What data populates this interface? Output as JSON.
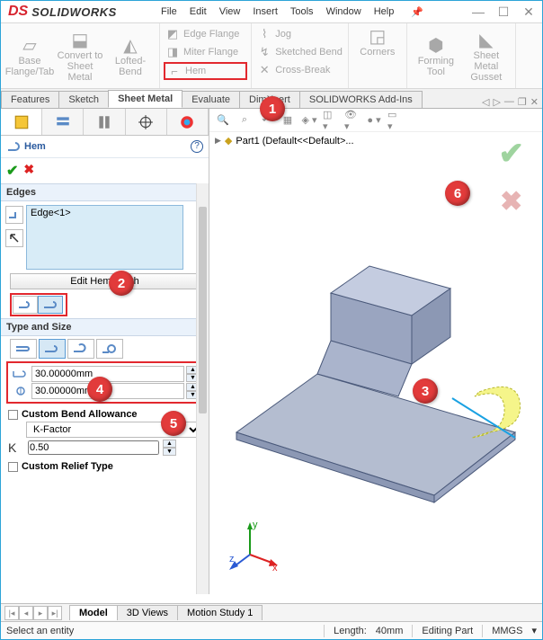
{
  "app": {
    "logo_prefix": "DS",
    "name": "SOLIDWORKS"
  },
  "menu": {
    "file": "File",
    "edit": "Edit",
    "view": "View",
    "insert": "Insert",
    "tools": "Tools",
    "window": "Window",
    "help": "Help"
  },
  "ribbon": {
    "base": "Base Flange/Tab",
    "convert": "Convert to Sheet Metal",
    "lofted": "Lofted-Bend",
    "edge_flange": "Edge Flange",
    "miter_flange": "Miter Flange",
    "hem": "Hem",
    "jog": "Jog",
    "sketched_bend": "Sketched Bend",
    "cross_break": "Cross-Break",
    "corners": "Corners",
    "forming": "Forming Tool",
    "gusset": "Sheet Metal Gusset"
  },
  "tabs": {
    "features": "Features",
    "sketch": "Sketch",
    "sheet_metal": "Sheet Metal",
    "evaluate": "Evaluate",
    "dimxpert": "DimXpert",
    "addins": "SOLIDWORKS Add-Ins"
  },
  "panel": {
    "title": "Hem",
    "edges_head": "Edges",
    "edge_item": "Edge<1>",
    "edit_hem": "Edit Hem Width",
    "type_head": "Type and Size",
    "dim1": "30.00000mm",
    "dim2": "30.00000mm",
    "cba": "Custom Bend Allowance",
    "kfactor_opt": "K-Factor",
    "k_val": "0.50",
    "crt": "Custom Relief Type"
  },
  "tree": {
    "part": "Part1  (Default<<Default>..."
  },
  "btabs": {
    "model": "Model",
    "views": "3D Views",
    "motion": "Motion Study 1"
  },
  "status": {
    "prompt": "Select an entity",
    "length_lbl": "Length:",
    "length_val": "40mm",
    "mode": "Editing Part",
    "units": "MMGS"
  },
  "callouts": {
    "c1": "1",
    "c2": "2",
    "c3": "3",
    "c4": "4",
    "c5": "5",
    "c6": "6"
  },
  "chart_data": null
}
